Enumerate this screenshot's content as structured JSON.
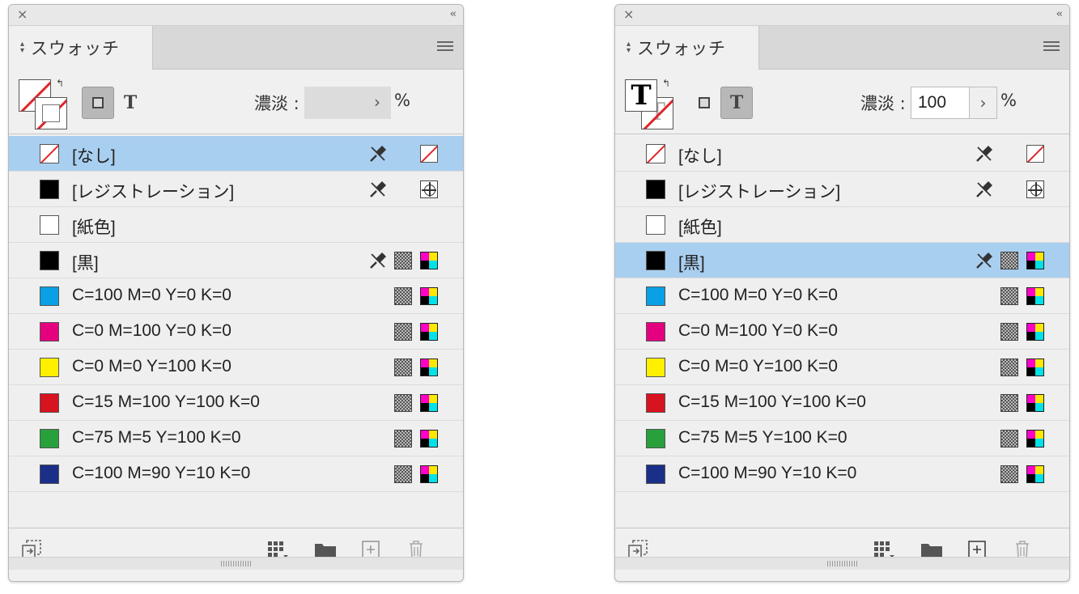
{
  "colors": {
    "panel_bg": "#f0f0f0",
    "selection": "#a9cff0",
    "none_slash": "#e0242a"
  },
  "panels": [
    {
      "id": "left",
      "close_glyph": "×",
      "collapse_glyph": "‹‹",
      "tab_label": "スウォッチ",
      "active_mode": "box",
      "tint_label": "濃淡 :",
      "tint_value": "",
      "tint_step_glyph": "›",
      "tint_unit": "%",
      "selected_row": 0
    },
    {
      "id": "right",
      "close_glyph": "×",
      "collapse_glyph": "‹‹",
      "tab_label": "スウォッチ",
      "active_mode": "text",
      "tint_label": "濃淡 :",
      "tint_value": "100",
      "tint_step_glyph": "›",
      "tint_unit": "%",
      "selected_row": 3
    }
  ],
  "swatches": [
    {
      "name": "[なし]",
      "color": "none",
      "locked": true,
      "indicator": "none"
    },
    {
      "name": "[レジストレーション]",
      "color": "#000000",
      "locked": true,
      "indicator": "registration"
    },
    {
      "name": "[紙色]",
      "color": "#ffffff",
      "locked": false,
      "indicator": ""
    },
    {
      "name": "[黒]",
      "color": "#000000",
      "locked": true,
      "indicator": "cmyk"
    },
    {
      "name": "C=100 M=0 Y=0 K=0",
      "color": "#0aa0e6",
      "locked": false,
      "indicator": "cmyk"
    },
    {
      "name": "C=0 M=100 Y=0 K=0",
      "color": "#e4007f",
      "locked": false,
      "indicator": "cmyk"
    },
    {
      "name": "C=0 M=0 Y=100 K=0",
      "color": "#fff000",
      "locked": false,
      "indicator": "cmyk"
    },
    {
      "name": "C=15 M=100 Y=100 K=0",
      "color": "#d7131f",
      "locked": false,
      "indicator": "cmyk"
    },
    {
      "name": "C=75 M=5 Y=100 K=0",
      "color": "#28a03c",
      "locked": false,
      "indicator": "cmyk"
    },
    {
      "name": "C=100 M=90 Y=10 K=0",
      "color": "#1a2f87",
      "locked": false,
      "indicator": "cmyk"
    }
  ],
  "footer_icons": [
    "import-swatches-icon",
    "swatch-view-icon",
    "new-color-group-icon",
    "new-swatch-icon",
    "delete-swatch-icon"
  ]
}
